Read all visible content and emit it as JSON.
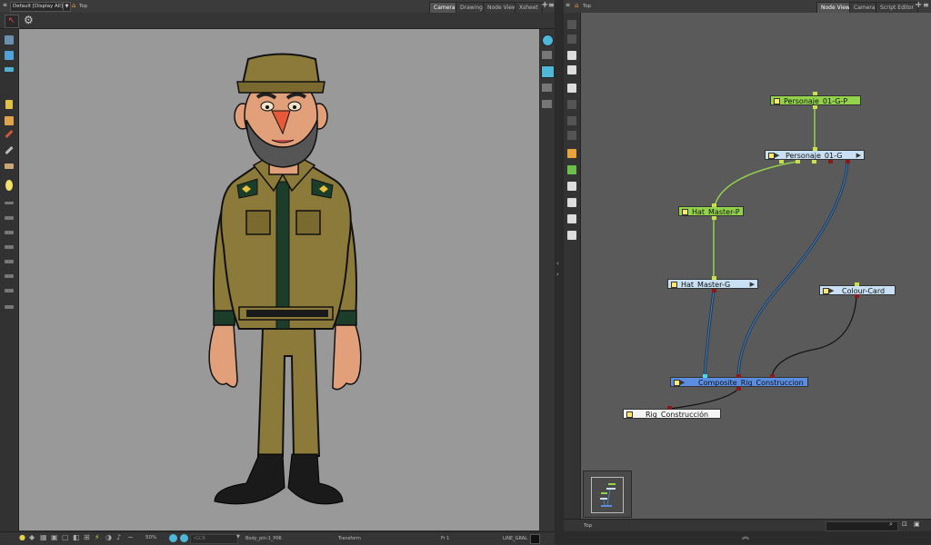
{
  "left": {
    "header": {
      "display_dropdown": "Default [Display All]",
      "view_label": "Top",
      "tabs": [
        {
          "label": "Camera",
          "active": true
        },
        {
          "label": "Drawing",
          "active": false
        },
        {
          "label": "Node View",
          "active": false
        },
        {
          "label": "Xsheet",
          "active": false
        }
      ]
    },
    "status": {
      "zoom": "50%",
      "color_field": "rGCB",
      "element": "Body_pin-1_P06",
      "tool": "Transform",
      "frame": "Fr 1",
      "mode": "LINE_GRAL"
    }
  },
  "right": {
    "header": {
      "view_label": "Top",
      "tabs": [
        {
          "label": "Node View",
          "active": true
        },
        {
          "label": "Camera",
          "active": false
        },
        {
          "label": "Script Editor",
          "active": false
        }
      ]
    },
    "nodes": {
      "peg_char": "Personaje_01-G-P",
      "group_char": "Personaje_01-G",
      "peg_hat": "Hat_Master-P",
      "group_hat": "Hat_Master-G",
      "colour_card": "Colour-Card",
      "composite": "Composite_Rig_Construccion",
      "display": "Rig_Construcción"
    },
    "status": {
      "view": "Top"
    }
  },
  "colors": {
    "peg": "#93d24b",
    "group": "#c8dff4",
    "composite": "#5b8de0",
    "canvas": "#999999"
  }
}
